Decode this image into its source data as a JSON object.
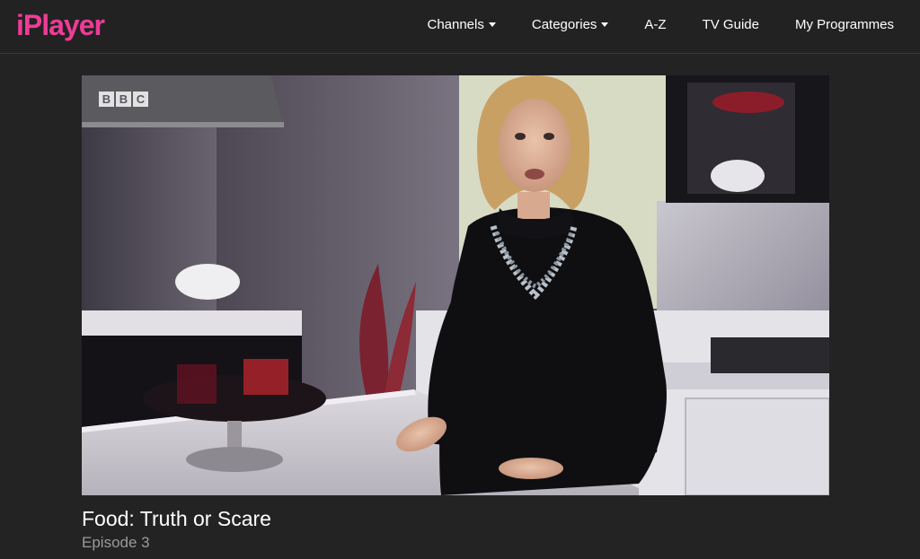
{
  "header": {
    "logo_text": "iPlayer",
    "brand_color": "#ee3c96",
    "nav": [
      {
        "label": "Channels",
        "has_dropdown": true
      },
      {
        "label": "Categories",
        "has_dropdown": true
      },
      {
        "label": "A-Z",
        "has_dropdown": false
      },
      {
        "label": "TV Guide",
        "has_dropdown": false
      },
      {
        "label": "My Programmes",
        "has_dropdown": false
      }
    ]
  },
  "player": {
    "watermark": [
      "B",
      "B",
      "C"
    ]
  },
  "programme": {
    "title": "Food: Truth or Scare",
    "episode": "Episode 3"
  },
  "colors": {
    "background": "#232323",
    "text": "#ffffff",
    "subtext": "#9a9a9a"
  }
}
